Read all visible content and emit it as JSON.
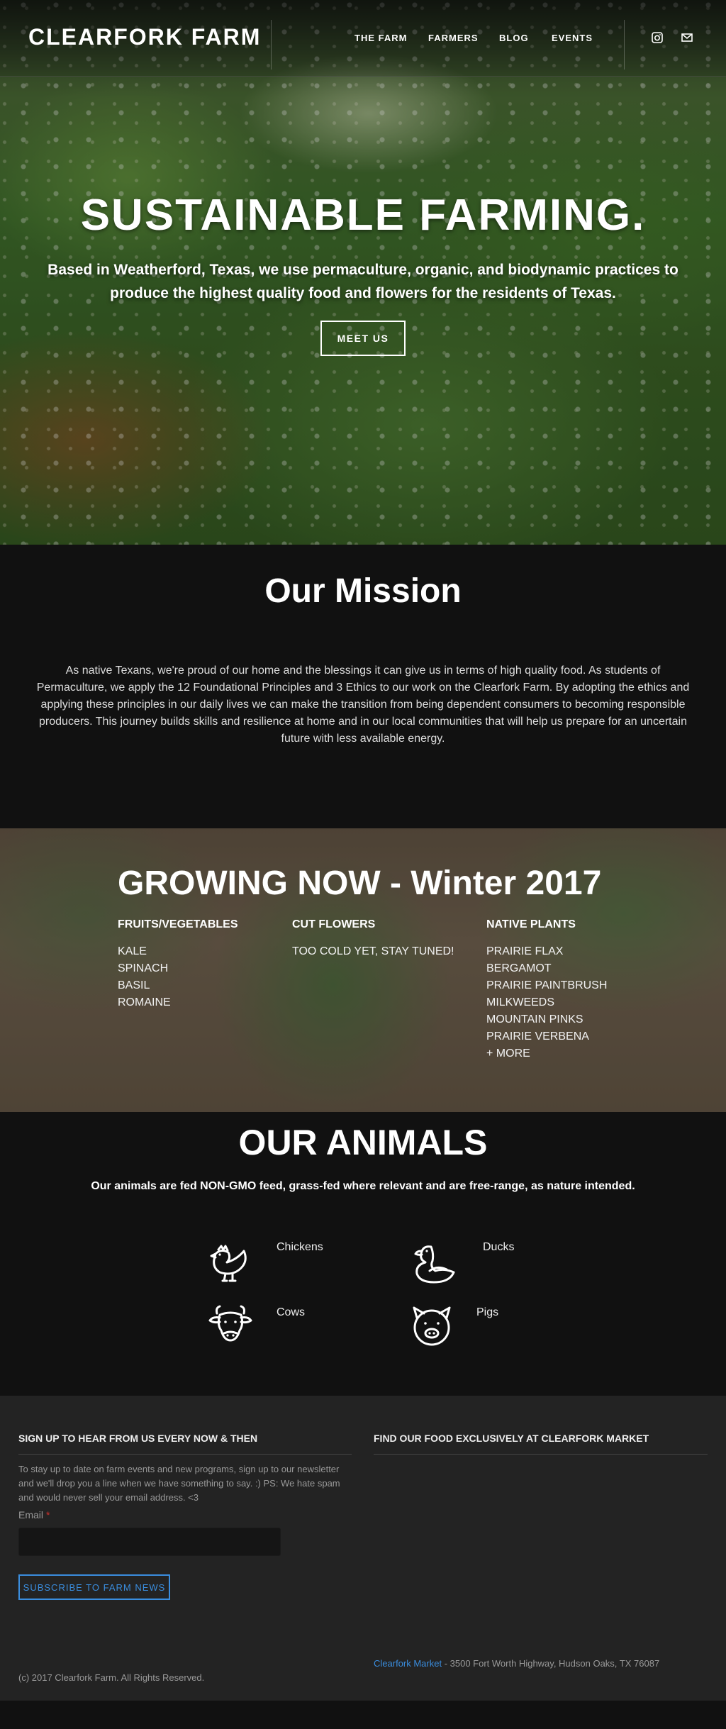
{
  "header": {
    "logo": "CLEARFORK FARM",
    "nav": [
      "THE FARM",
      "FARMERS",
      "BLOG",
      "EVENTS"
    ],
    "social_icons": [
      "instagram-icon",
      "mail-icon"
    ]
  },
  "hero": {
    "title": "SUSTAINABLE FARMING.",
    "subtitle": "Based in Weatherford, Texas, we use permaculture, organic, and biodynamic practices to produce the highest quality food and flowers for the residents of Texas.",
    "button": "MEET US"
  },
  "mission": {
    "title": "Our Mission",
    "body": "As native Texans, we're proud of our home and the blessings it can give us in terms of high quality food. As students of Permaculture, we apply the 12 Foundational Principles and 3 Ethics to our work on the Clearfork Farm. By adopting the ethics and applying these principles in our daily lives we can make the transition from being dependent consumers to becoming responsible producers. This journey builds skills and resilience at home and in our local communities that will help us prepare for an uncertain future with less available energy."
  },
  "growing": {
    "title": "GROWING NOW - Winter 2017",
    "columns": [
      {
        "heading": "FRUITS/VEGETABLES",
        "items": [
          "KALE",
          "SPINACH",
          "BASIL",
          "ROMAINE"
        ]
      },
      {
        "heading": "CUT FLOWERS",
        "items": [
          "TOO COLD YET, STAY TUNED!"
        ]
      },
      {
        "heading": "NATIVE PLANTS",
        "items": [
          "PRAIRIE FLAX",
          "BERGAMOT",
          "PRAIRIE PAINTBRUSH",
          "MILKWEEDS",
          "MOUNTAIN PINKS",
          "PRAIRIE VERBENA",
          "+ MORE"
        ]
      }
    ]
  },
  "animals": {
    "title": "OUR ANIMALS",
    "subtitle": "Our animals are fed NON-GMO feed, grass-fed where relevant and are free-range, as nature intended.",
    "list": [
      {
        "label": "Chickens",
        "icon": "chicken-icon"
      },
      {
        "label": "Ducks",
        "icon": "duck-icon"
      },
      {
        "label": "Cows",
        "icon": "cow-icon"
      },
      {
        "label": "Pigs",
        "icon": "pig-icon"
      }
    ]
  },
  "footer": {
    "signup_heading": "SIGN UP TO HEAR FROM US EVERY NOW & THEN",
    "signup_text": "To stay up to date on farm events and new programs, sign up to our newsletter and we'll drop you a line when we have something to say. :) PS: We hate spam and would never sell your email address. <3",
    "email_label": "Email",
    "email_required": "*",
    "email_value": "",
    "subscribe_button": "SUBSCRIBE TO FARM NEWS",
    "market_heading": "FIND OUR FOOD EXCLUSIVELY AT CLEARFORK MARKET",
    "market_link": "Clearfork Market",
    "market_address": " - 3500 Fort Worth Highway, Hudson Oaks, TX 76087",
    "copyright": "(c) 2017 Clearfork Farm. All Rights Reserved."
  },
  "colors": {
    "accent": "#3a8dde",
    "required": "#d0312d",
    "dark_bg": "#111111",
    "footer_bg": "#232323"
  }
}
